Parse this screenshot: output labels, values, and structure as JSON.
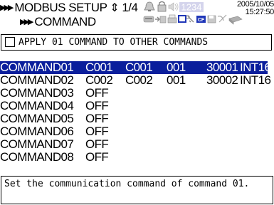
{
  "header": {
    "title": "MODBUS SETUP",
    "page_indicator": "1/4",
    "breadcrumb": "COMMAND",
    "date": "2005/10/05",
    "time": "15:27:50",
    "memory_counter": "1234",
    "icons": [
      "alarm-bell-icon",
      "lock-icon",
      "speaker-icon",
      "network-icon",
      "printer-icon",
      "display-icon",
      "key-icon",
      "cf-card-icon",
      "floppy-icon",
      "satellite-icon"
    ]
  },
  "apply": {
    "label": "APPLY 01 COMMAND TO OTHER COMMANDS",
    "checked": false
  },
  "commands": [
    {
      "name": "COMMAND01",
      "f1": "C001",
      "f2": "C001",
      "f3": "001",
      "f4": "30001",
      "f5": "INT16",
      "selected": true
    },
    {
      "name": "COMMAND02",
      "f1": "C002",
      "f2": "C002",
      "f3": "001",
      "f4": "30002",
      "f5": "INT16",
      "selected": false
    },
    {
      "name": "COMMAND03",
      "f1": "OFF",
      "f2": "",
      "f3": "",
      "f4": "",
      "f5": "",
      "selected": false
    },
    {
      "name": "COMMAND04",
      "f1": "OFF",
      "f2": "",
      "f3": "",
      "f4": "",
      "f5": "",
      "selected": false
    },
    {
      "name": "COMMAND05",
      "f1": "OFF",
      "f2": "",
      "f3": "",
      "f4": "",
      "f5": "",
      "selected": false
    },
    {
      "name": "COMMAND06",
      "f1": "OFF",
      "f2": "",
      "f3": "",
      "f4": "",
      "f5": "",
      "selected": false
    },
    {
      "name": "COMMAND07",
      "f1": "OFF",
      "f2": "",
      "f3": "",
      "f4": "",
      "f5": "",
      "selected": false
    },
    {
      "name": "COMMAND08",
      "f1": "OFF",
      "f2": "",
      "f3": "",
      "f4": "",
      "f5": "",
      "selected": false
    }
  ],
  "help": {
    "text": "Set the communication command of command 01."
  },
  "colors": {
    "selection": "#0a1e9c",
    "memory_bar": "#1f36b8",
    "cf_badge": "#1f36b8"
  }
}
